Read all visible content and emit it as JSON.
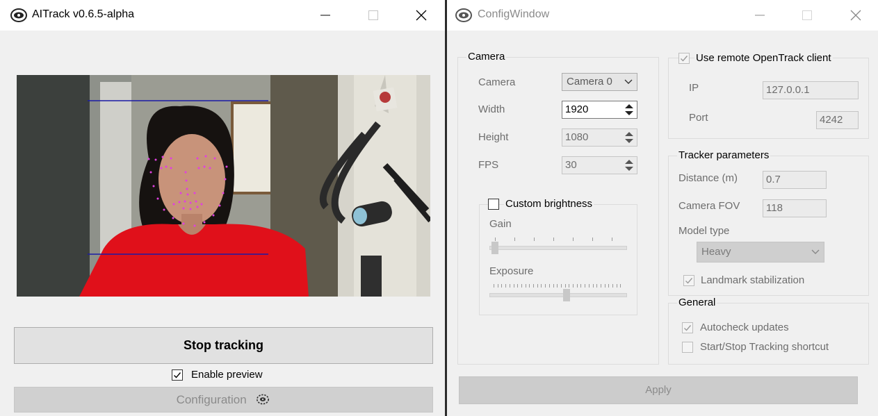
{
  "main_window": {
    "title": "AITrack v0.6.5-alpha",
    "stop_button": "Stop tracking",
    "enable_preview_label": "Enable preview",
    "enable_preview_checked": true,
    "config_button": "Configuration"
  },
  "config_window": {
    "title": "ConfigWindow",
    "camera_group": {
      "title": "Camera",
      "camera_label": "Camera",
      "camera_value": "Camera 0",
      "width_label": "Width",
      "width_value": "1920",
      "height_label": "Height",
      "height_value": "1080",
      "fps_label": "FPS",
      "fps_value": "30"
    },
    "brightness_group": {
      "title": "Custom brightness",
      "checked": false,
      "gain_label": "Gain",
      "gain_level": 0.0,
      "exposure_label": "Exposure",
      "exposure_level": 0.55
    },
    "remote_group": {
      "title": "Use remote OpenTrack client",
      "checked": true,
      "ip_label": "IP",
      "ip_value": "127.0.0.1",
      "port_label": "Port",
      "port_value": "4242"
    },
    "tracker_group": {
      "title": "Tracker parameters",
      "distance_label": "Distance (m)",
      "distance_value": "0.7",
      "fov_label": "Camera FOV",
      "fov_value": "118",
      "model_label": "Model type",
      "model_value": "Heavy",
      "stabilization_label": "Landmark stabilization",
      "stabilization_checked": true
    },
    "general_group": {
      "title": "General",
      "autocheck_label": "Autocheck updates",
      "autocheck_checked": true,
      "shortcut_label": "Start/Stop Tracking shortcut",
      "shortcut_checked": false
    },
    "apply_button": "Apply"
  },
  "colors": {
    "tracking_lines": "#1a1aa6",
    "landmarks": "#e040e0",
    "shirt": "#e0101a"
  }
}
